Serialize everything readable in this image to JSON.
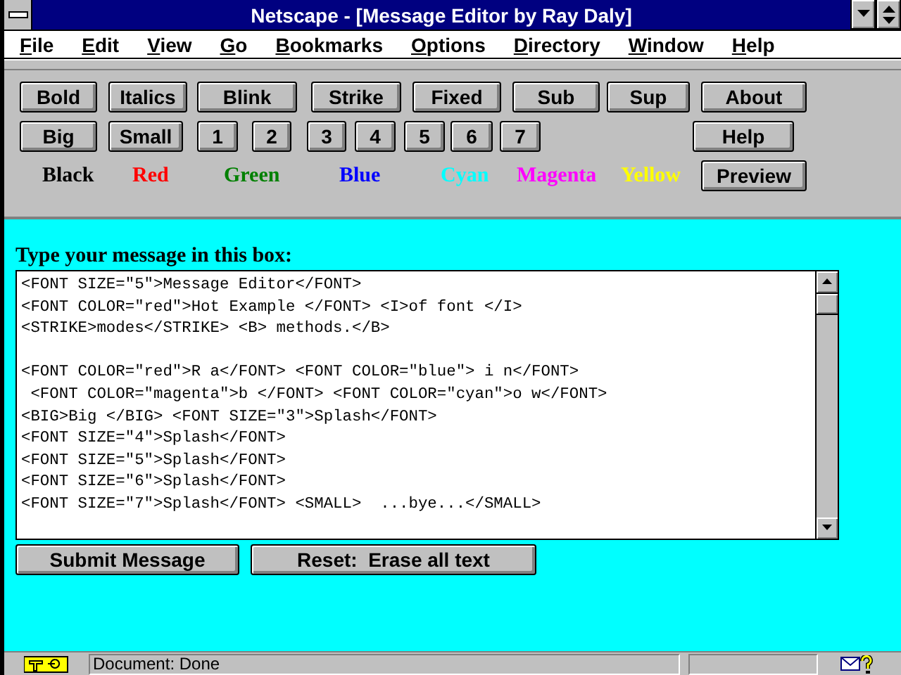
{
  "window": {
    "title": "Netscape - [Message Editor by Ray Daly]"
  },
  "menu": [
    "File",
    "Edit",
    "View",
    "Go",
    "Bookmarks",
    "Options",
    "Directory",
    "Window",
    "Help"
  ],
  "toolbar": {
    "row_1": [
      "Bold",
      "Italics",
      "Blink",
      "Strike",
      "Fixed",
      "Sub",
      "Sup",
      "About"
    ],
    "row_2": [
      "Big",
      "Small",
      "1",
      "2",
      "3",
      "4",
      "5",
      "6",
      "7",
      "Help"
    ],
    "colors": [
      {
        "label": "Black",
        "color": "#000000"
      },
      {
        "label": "Red",
        "color": "#ff0000"
      },
      {
        "label": "Green",
        "color": "#008000"
      },
      {
        "label": "Blue",
        "color": "#0000ff"
      },
      {
        "label": "Cyan",
        "color": "#00ffff"
      },
      {
        "label": "Magenta",
        "color": "#ff00ff"
      },
      {
        "label": "Yellow",
        "color": "#ffff00"
      }
    ],
    "preview": "Preview"
  },
  "form": {
    "label": "Type your message in this box:",
    "message": "<FONT SIZE=\"5\">Message Editor</FONT>\n<FONT COLOR=\"red\">Hot Example </FONT> <I>of font </I>\n<STRIKE>modes</STRIKE> <B> methods.</B>\n\n<FONT COLOR=\"red\">R a</FONT> <FONT COLOR=\"blue\"> i n</FONT>\n <FONT COLOR=\"magenta\">b </FONT> <FONT COLOR=\"cyan\">o w</FONT>\n<BIG>Big </BIG> <FONT SIZE=\"3\">Splash</FONT>\n<FONT SIZE=\"4\">Splash</FONT>\n<FONT SIZE=\"5\">Splash</FONT>\n<FONT SIZE=\"6\">Splash</FONT>\n<FONT SIZE=\"7\">Splash</FONT> <SMALL>  ...bye...</SMALL>",
    "buttons": [
      "Submit Message",
      "Reset:  Erase all text"
    ]
  },
  "status_bar": {
    "text": "Document: Done"
  }
}
